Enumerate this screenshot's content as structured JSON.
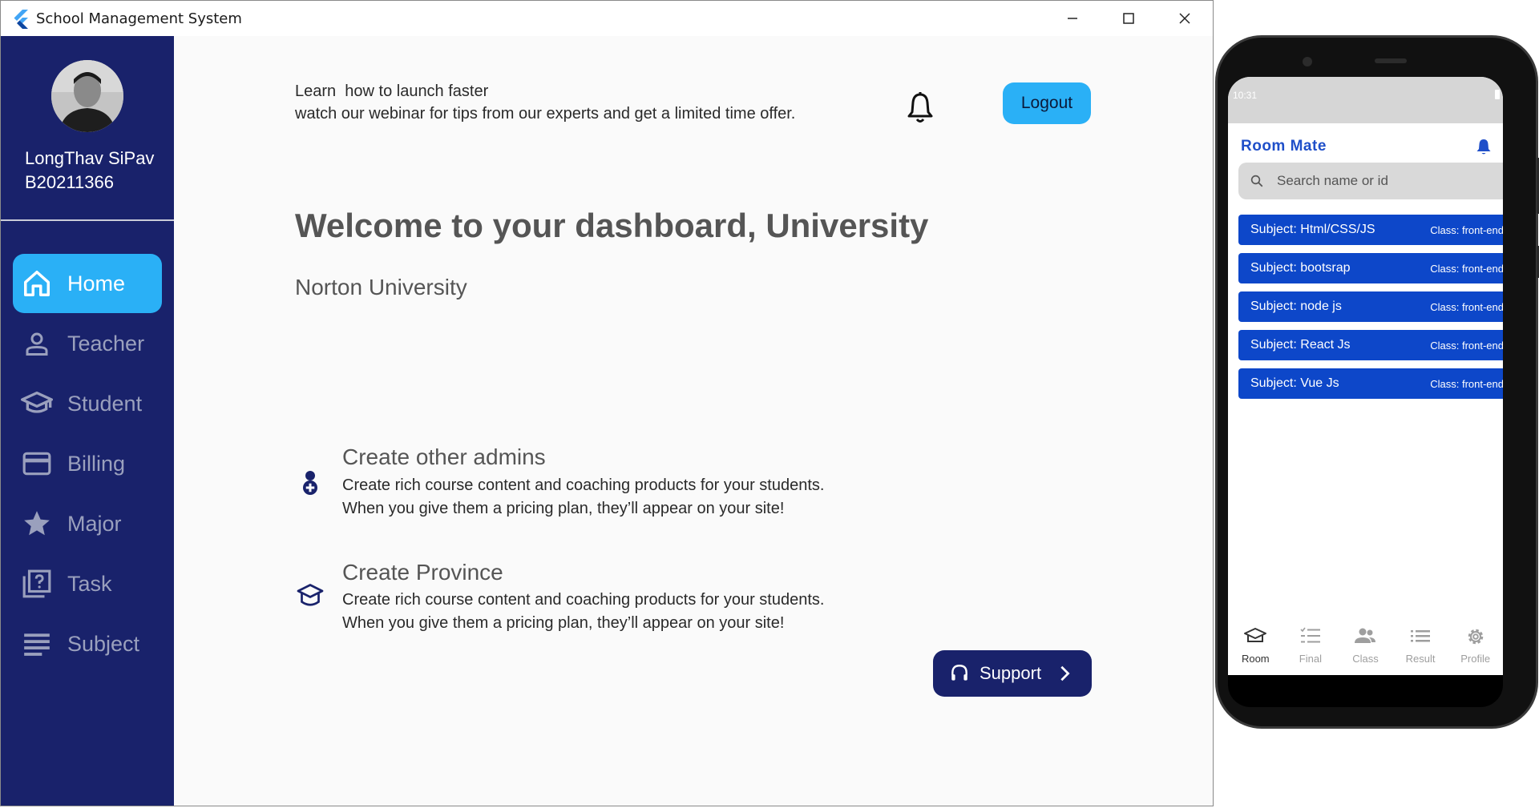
{
  "window": {
    "title": "School Management System",
    "controls": [
      "minimize",
      "maximize",
      "close"
    ]
  },
  "sidebar": {
    "user_name": "LongThav SiPav",
    "user_id": "B20211366",
    "items": [
      {
        "label": "Home",
        "icon": "home-icon",
        "active": true
      },
      {
        "label": "Teacher",
        "icon": "person-icon",
        "active": false
      },
      {
        "label": "Student",
        "icon": "graduation-cap-icon",
        "active": false
      },
      {
        "label": "Billing",
        "icon": "credit-card-icon",
        "active": false
      },
      {
        "label": "Major",
        "icon": "star-icon",
        "active": false
      },
      {
        "label": "Task",
        "icon": "quiz-icon",
        "active": false
      },
      {
        "label": "Subject",
        "icon": "list-lines-icon",
        "active": false
      }
    ]
  },
  "main": {
    "promo_line1": "Learn  how to launch faster",
    "promo_line2": "watch our webinar for tips from our experts and get a limited time offer.",
    "logout_label": "Logout",
    "welcome": "Welcome to your dashboard, University",
    "university": "Norton University",
    "features": [
      {
        "title": "Create other admins",
        "desc_line1": "Create rich course content and coaching products for your students.",
        "desc_line2": "When you give them a pricing plan, they’ll appear on your site!",
        "icon": "add-person-icon"
      },
      {
        "title": "Create Province",
        "desc_line1": "Create rich course content and coaching products for your students.",
        "desc_line2": "When you give them a pricing plan, they’ll appear on your site!",
        "icon": "school-icon"
      }
    ],
    "support_label": "Support"
  },
  "phone": {
    "status_time": "10:31",
    "title": "Room Mate",
    "search_placeholder": "Search name or id",
    "subjects": [
      {
        "subject": "Subject: Html/CSS/JS",
        "class": "Class: front-end"
      },
      {
        "subject": "Subject: bootsrap",
        "class": "Class: front-end"
      },
      {
        "subject": "Subject: node js",
        "class": "Class: front-end"
      },
      {
        "subject": "Subject: React Js",
        "class": "Class: front-end"
      },
      {
        "subject": "Subject: Vue Js",
        "class": "Class: front-end"
      }
    ],
    "bottom_nav": [
      {
        "label": "Room",
        "icon": "school-icon",
        "active": true
      },
      {
        "label": "Final",
        "icon": "checklist-icon",
        "active": false
      },
      {
        "label": "Class",
        "icon": "group-icon",
        "active": false
      },
      {
        "label": "Result",
        "icon": "list-icon",
        "active": false
      },
      {
        "label": "Profile",
        "icon": "gear-icon",
        "active": false
      }
    ]
  },
  "colors": {
    "sidebar_bg": "#19226b",
    "accent_blue": "#2ab0f6",
    "card_blue": "#0d47c9",
    "title_blue": "#1f4fc9"
  }
}
